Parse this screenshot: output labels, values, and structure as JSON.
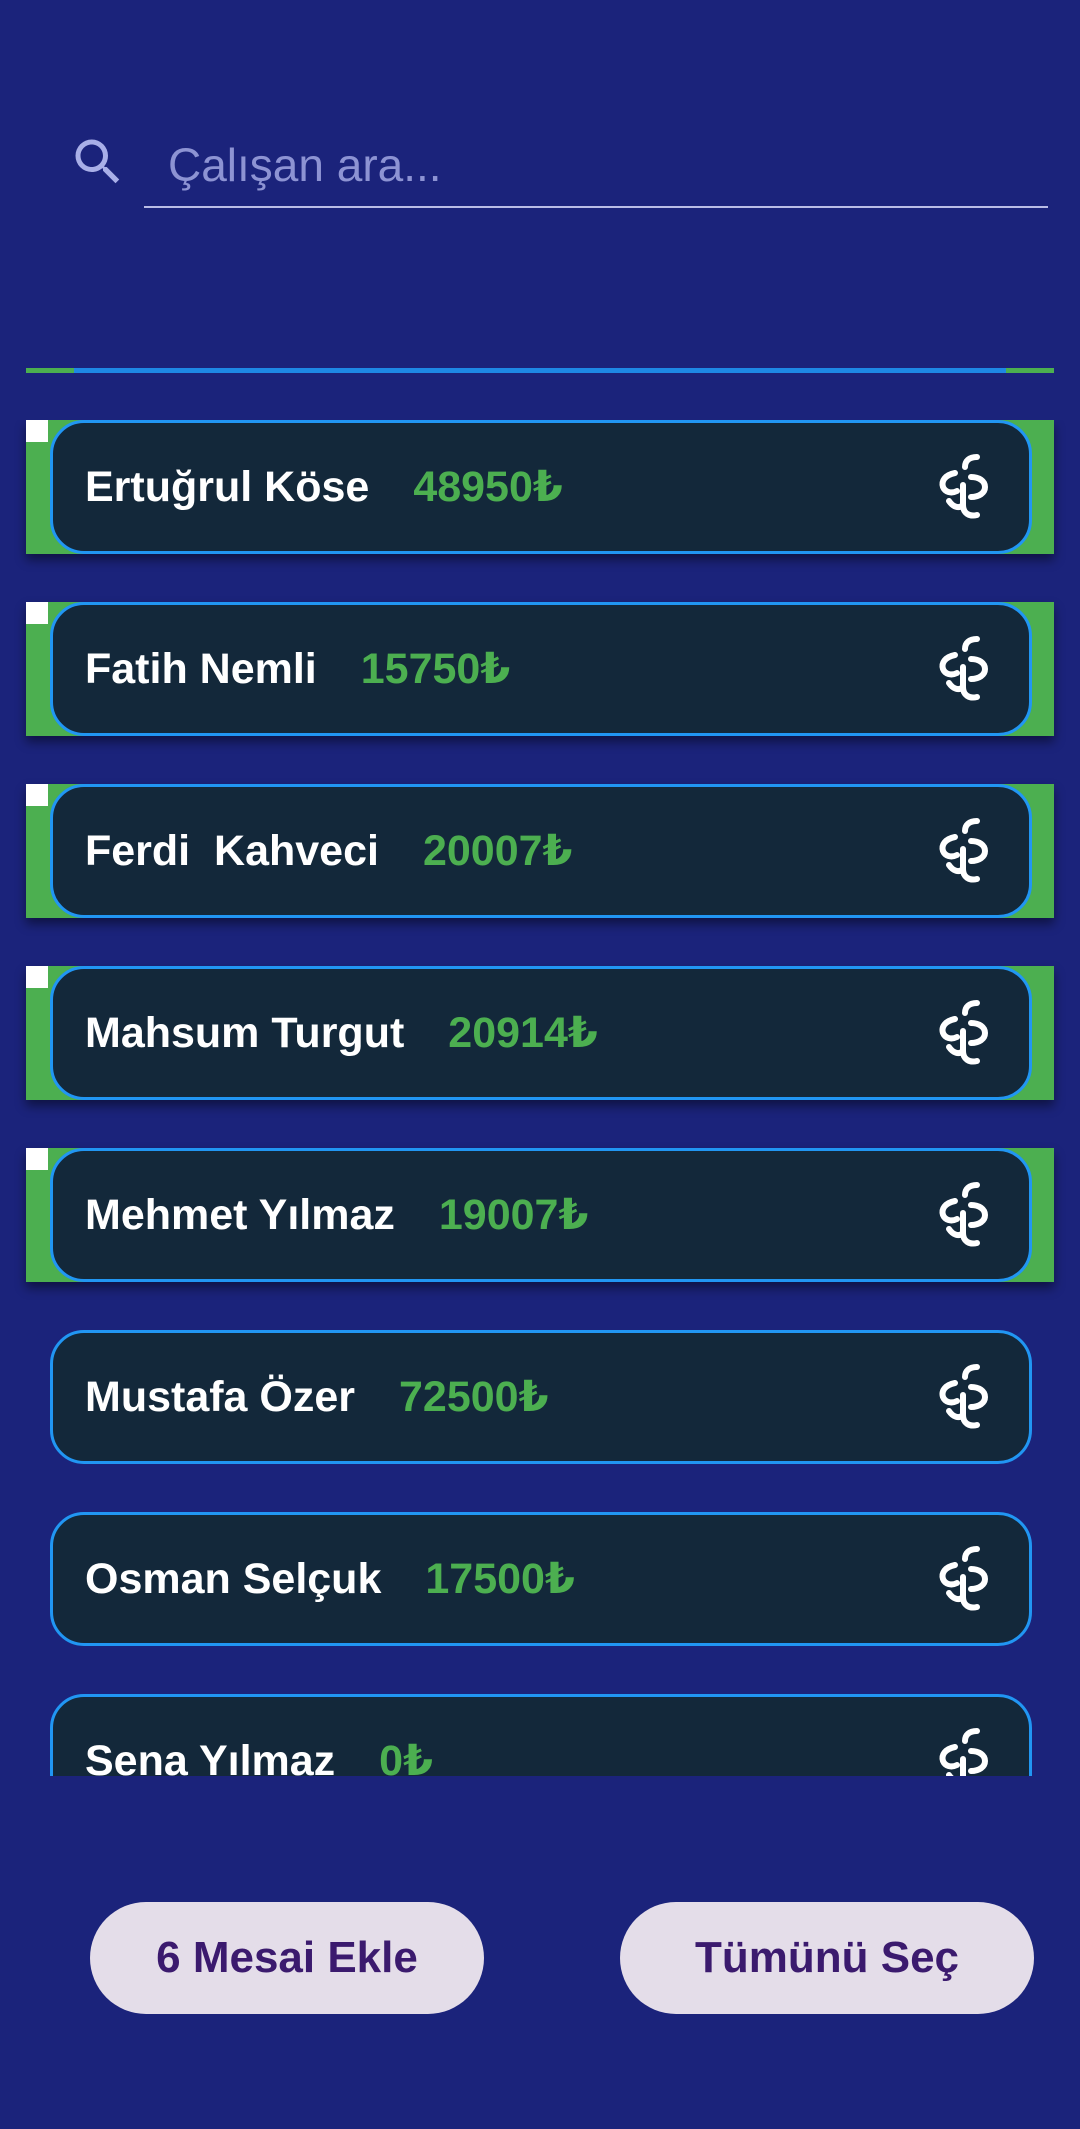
{
  "search": {
    "placeholder": "Çalışan ara...",
    "value": ""
  },
  "employees": [
    {
      "name": "Ertuğrul Köse",
      "salary": "48950₺",
      "selected": true
    },
    {
      "name": "Fatih Nemli",
      "salary": "15750₺",
      "selected": true
    },
    {
      "name": "Ferdi  Kahveci",
      "salary": "20007₺",
      "selected": true
    },
    {
      "name": "Mahsum Turgut",
      "salary": "20914₺",
      "selected": true
    },
    {
      "name": "Mehmet Yılmaz",
      "salary": "19007₺",
      "selected": true
    },
    {
      "name": "Mustafa Özer",
      "salary": "72500₺",
      "selected": false
    },
    {
      "name": "Osman Selçuk",
      "salary": "17500₺",
      "selected": false
    },
    {
      "name": "Sena Yılmaz",
      "salary": "0₺",
      "selected": false
    }
  ],
  "footer": {
    "add_overtime_label": "6 Mesai Ekle",
    "select_all_label": "Tümünü Seç"
  },
  "colors": {
    "background": "#1b237b",
    "card": "#13283a",
    "card_border": "#2196f3",
    "selected": "#4caf50",
    "salary": "#4caf50",
    "button_bg": "#e4dde9",
    "button_text": "#3b1a6e"
  }
}
